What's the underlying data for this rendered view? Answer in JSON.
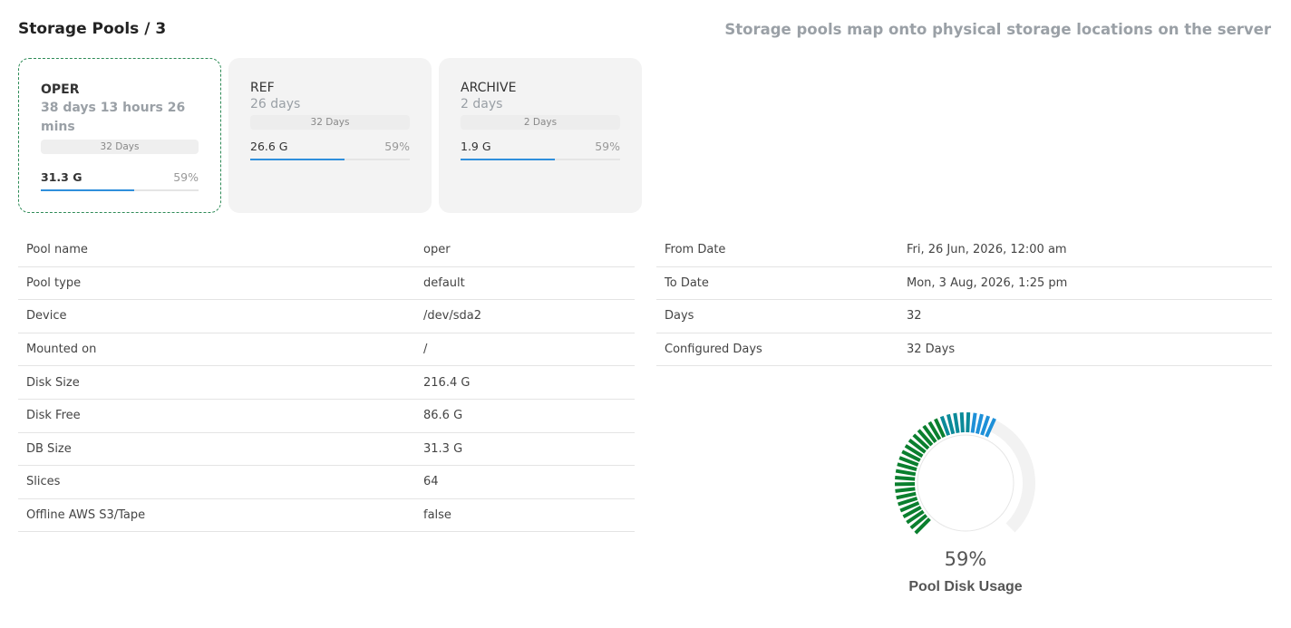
{
  "header": {
    "title": "Storage Pools / 3",
    "subtitle": "Storage pools map onto physical storage locations on the server"
  },
  "pools": [
    {
      "name": "OPER",
      "duration": "38 days 13 hours 26 mins",
      "days_label": "32 Days",
      "size": "31.3 G",
      "pct": "59%",
      "usage": 0.59,
      "selected": true
    },
    {
      "name": "REF",
      "duration": "26 days",
      "days_label": "32 Days",
      "size": "26.6 G",
      "pct": "59%",
      "usage": 0.59,
      "selected": false
    },
    {
      "name": "ARCHIVE",
      "duration": "2 days",
      "days_label": "2 Days",
      "size": "1.9 G",
      "pct": "59%",
      "usage": 0.59,
      "selected": false
    }
  ],
  "details": [
    {
      "key": "Pool name",
      "value": "oper"
    },
    {
      "key": "Pool type",
      "value": "default"
    },
    {
      "key": "Device",
      "value": "/dev/sda2"
    },
    {
      "key": "Mounted on",
      "value": "/"
    },
    {
      "key": "Disk Size",
      "value": "216.4 G"
    },
    {
      "key": "Disk Free",
      "value": "86.6 G"
    },
    {
      "key": "DB Size",
      "value": "31.3 G"
    },
    {
      "key": "Slices",
      "value": "64"
    },
    {
      "key": "Offline AWS S3/Tape",
      "value": "false"
    }
  ],
  "dates": [
    {
      "key": "From Date",
      "value": "Fri, 26 Jun, 2026, 12:00 am"
    },
    {
      "key": "To Date",
      "value": "Mon, 3 Aug, 2026, 1:25 pm"
    },
    {
      "key": "Days",
      "value": "32"
    },
    {
      "key": "Configured Days",
      "value": "32 Days"
    }
  ],
  "gauge": {
    "value": 0.59,
    "pct_text": "59%",
    "label": "Pool Disk Usage",
    "colors": {
      "low": "#0a7f2e",
      "mid": "#0b8a99",
      "high": "#1e90d8",
      "track": "#f2f2f2",
      "inner": "#e6e6e6"
    }
  }
}
